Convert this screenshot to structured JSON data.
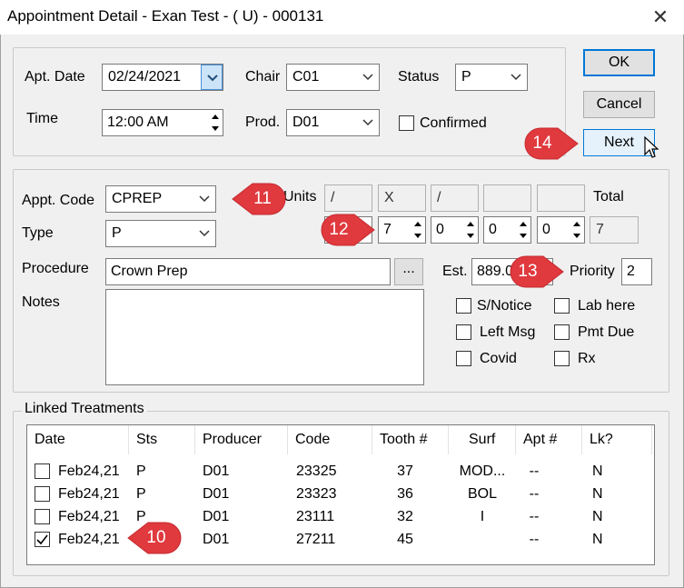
{
  "window": {
    "title": "Appointment Detail - Exan Test - ( U) - 000131",
    "close": "✕"
  },
  "top": {
    "apt_date_label": "Apt. Date",
    "apt_date": "02/24/2021",
    "time_label": "Time",
    "time": "12:00 AM",
    "chair_label": "Chair",
    "chair": "C01",
    "prod_label": "Prod.",
    "prod": "D01",
    "status_label": "Status",
    "status": "P",
    "confirmed_label": "Confirmed"
  },
  "buttons": {
    "ok": "OK",
    "cancel": "Cancel",
    "next": "Next"
  },
  "middle": {
    "appt_code_label": "Appt. Code",
    "appt_code": "CPREP",
    "type_label": "Type",
    "type": "P",
    "procedure_label": "Procedure",
    "procedure": "Crown Prep",
    "procedure_btn": "...",
    "notes_label": "Notes",
    "notes": "",
    "units_label": "Units",
    "total_label": "Total",
    "unit_boxes": [
      "/",
      "X",
      "/",
      "",
      ""
    ],
    "unit_spins": [
      "7",
      "0",
      "0",
      "0"
    ],
    "total": "7",
    "est_label": "Est.",
    "est": "889.0",
    "priority_label": "Priority",
    "priority": "2",
    "checks": {
      "s_notice": "S/Notice",
      "lab_here": "Lab here",
      "left_msg": "Left Msg",
      "pmt_due": "Pmt Due",
      "covid": "Covid",
      "rx": "Rx"
    }
  },
  "linked": {
    "title": "Linked Treatments",
    "columns": [
      "Date",
      "Sts",
      "Producer",
      "Code",
      "Tooth #",
      "Surf",
      "Apt #",
      "Lk?"
    ],
    "rows": [
      {
        "checked": false,
        "date": "Feb24,21",
        "sts": "P",
        "producer": "D01",
        "code": "23325",
        "tooth": "37",
        "surf": "MOD...",
        "apt": "--",
        "lk": "N"
      },
      {
        "checked": false,
        "date": "Feb24,21",
        "sts": "P",
        "producer": "D01",
        "code": "23323",
        "tooth": "36",
        "surf": "BOL",
        "apt": "--",
        "lk": "N"
      },
      {
        "checked": false,
        "date": "Feb24,21",
        "sts": "P",
        "producer": "D01",
        "code": "23111",
        "tooth": "32",
        "surf": "I",
        "apt": "--",
        "lk": "N"
      },
      {
        "checked": true,
        "date": "Feb24,21",
        "sts": "",
        "producer": "D01",
        "code": "27211",
        "tooth": "45",
        "surf": "",
        "apt": "--",
        "lk": "N"
      }
    ]
  },
  "callouts": {
    "c10": "10",
    "c11": "11",
    "c12": "12",
    "c13": "13",
    "c14": "14"
  },
  "colors": {
    "callout": "#e0393e",
    "accent": "#0078d7"
  }
}
